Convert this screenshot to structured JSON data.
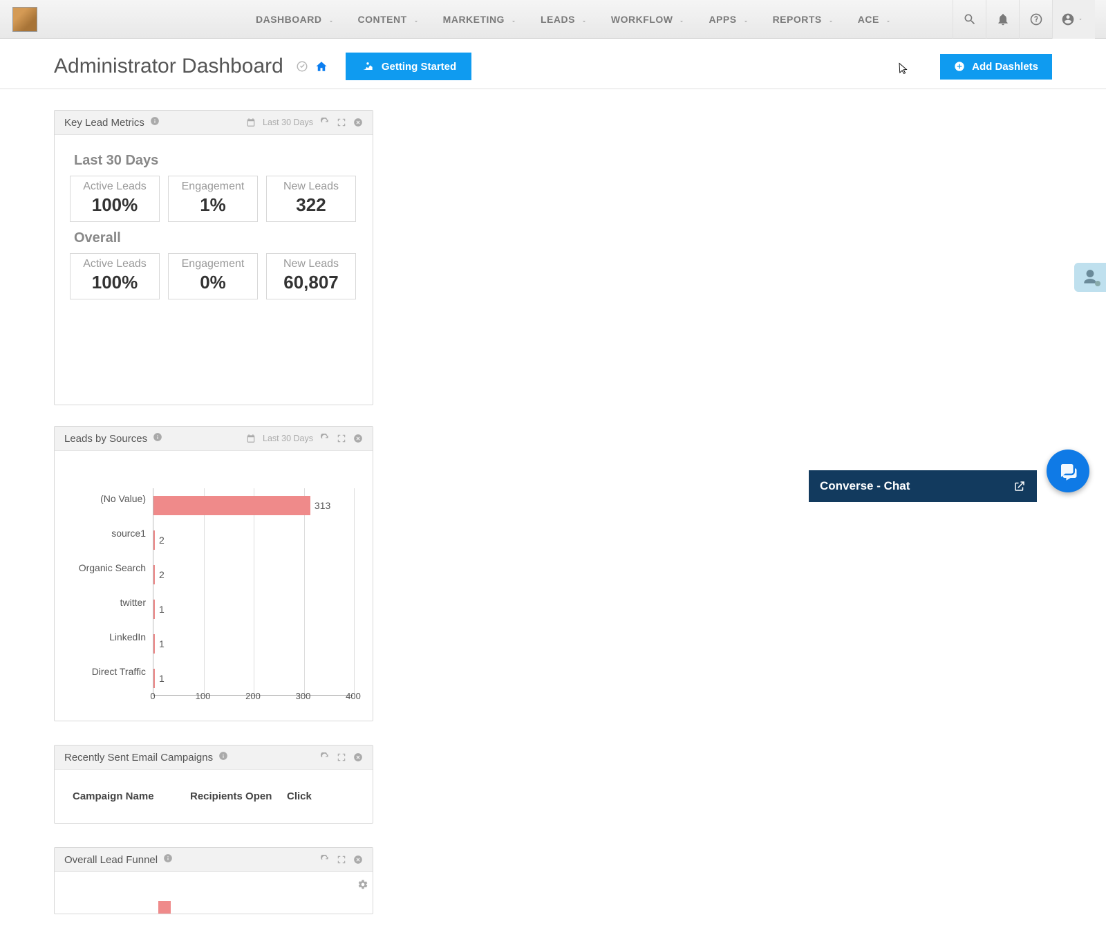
{
  "nav": {
    "items": [
      "DASHBOARD",
      "CONTENT",
      "MARKETING",
      "LEADS",
      "WORKFLOW",
      "APPS",
      "REPORTS",
      "ACE"
    ]
  },
  "page": {
    "title": "Administrator Dashboard",
    "getting_started": "Getting Started",
    "add_dashlets": "Add Dashlets"
  },
  "dashlets": {
    "key_lead_metrics": {
      "title": "Key Lead Metrics",
      "period": "Last 30 Days",
      "section1_title": "Last 30 Days",
      "section2_title": "Overall",
      "last30": [
        {
          "label": "Active Leads",
          "value": "100%"
        },
        {
          "label": "Engagement",
          "value": "1%"
        },
        {
          "label": "New Leads",
          "value": "322"
        }
      ],
      "overall": [
        {
          "label": "Active Leads",
          "value": "100%"
        },
        {
          "label": "Engagement",
          "value": "0%"
        },
        {
          "label": "New Leads",
          "value": "60,807"
        }
      ]
    },
    "leads_by_sources": {
      "title": "Leads by Sources",
      "period": "Last 30 Days"
    },
    "recent_campaigns": {
      "title": "Recently Sent Email Campaigns",
      "columns": {
        "c1": "Campaign Name",
        "c2": "Recipients Open",
        "c3": "Click"
      }
    },
    "funnel": {
      "title": "Overall Lead Funnel"
    }
  },
  "chart_data": {
    "type": "bar",
    "orientation": "horizontal",
    "title": "Leads by Sources",
    "xlabel": "",
    "ylabel": "",
    "xlim": [
      0,
      400
    ],
    "xticks": [
      0,
      100,
      200,
      300,
      400
    ],
    "categories": [
      "(No Value)",
      "source1",
      "Organic Search",
      "twitter",
      "LinkedIn",
      "Direct Traffic"
    ],
    "values": [
      313,
      2,
      2,
      1,
      1,
      1
    ],
    "color": "#ef8a8a"
  },
  "chat": {
    "title": "Converse - Chat"
  }
}
